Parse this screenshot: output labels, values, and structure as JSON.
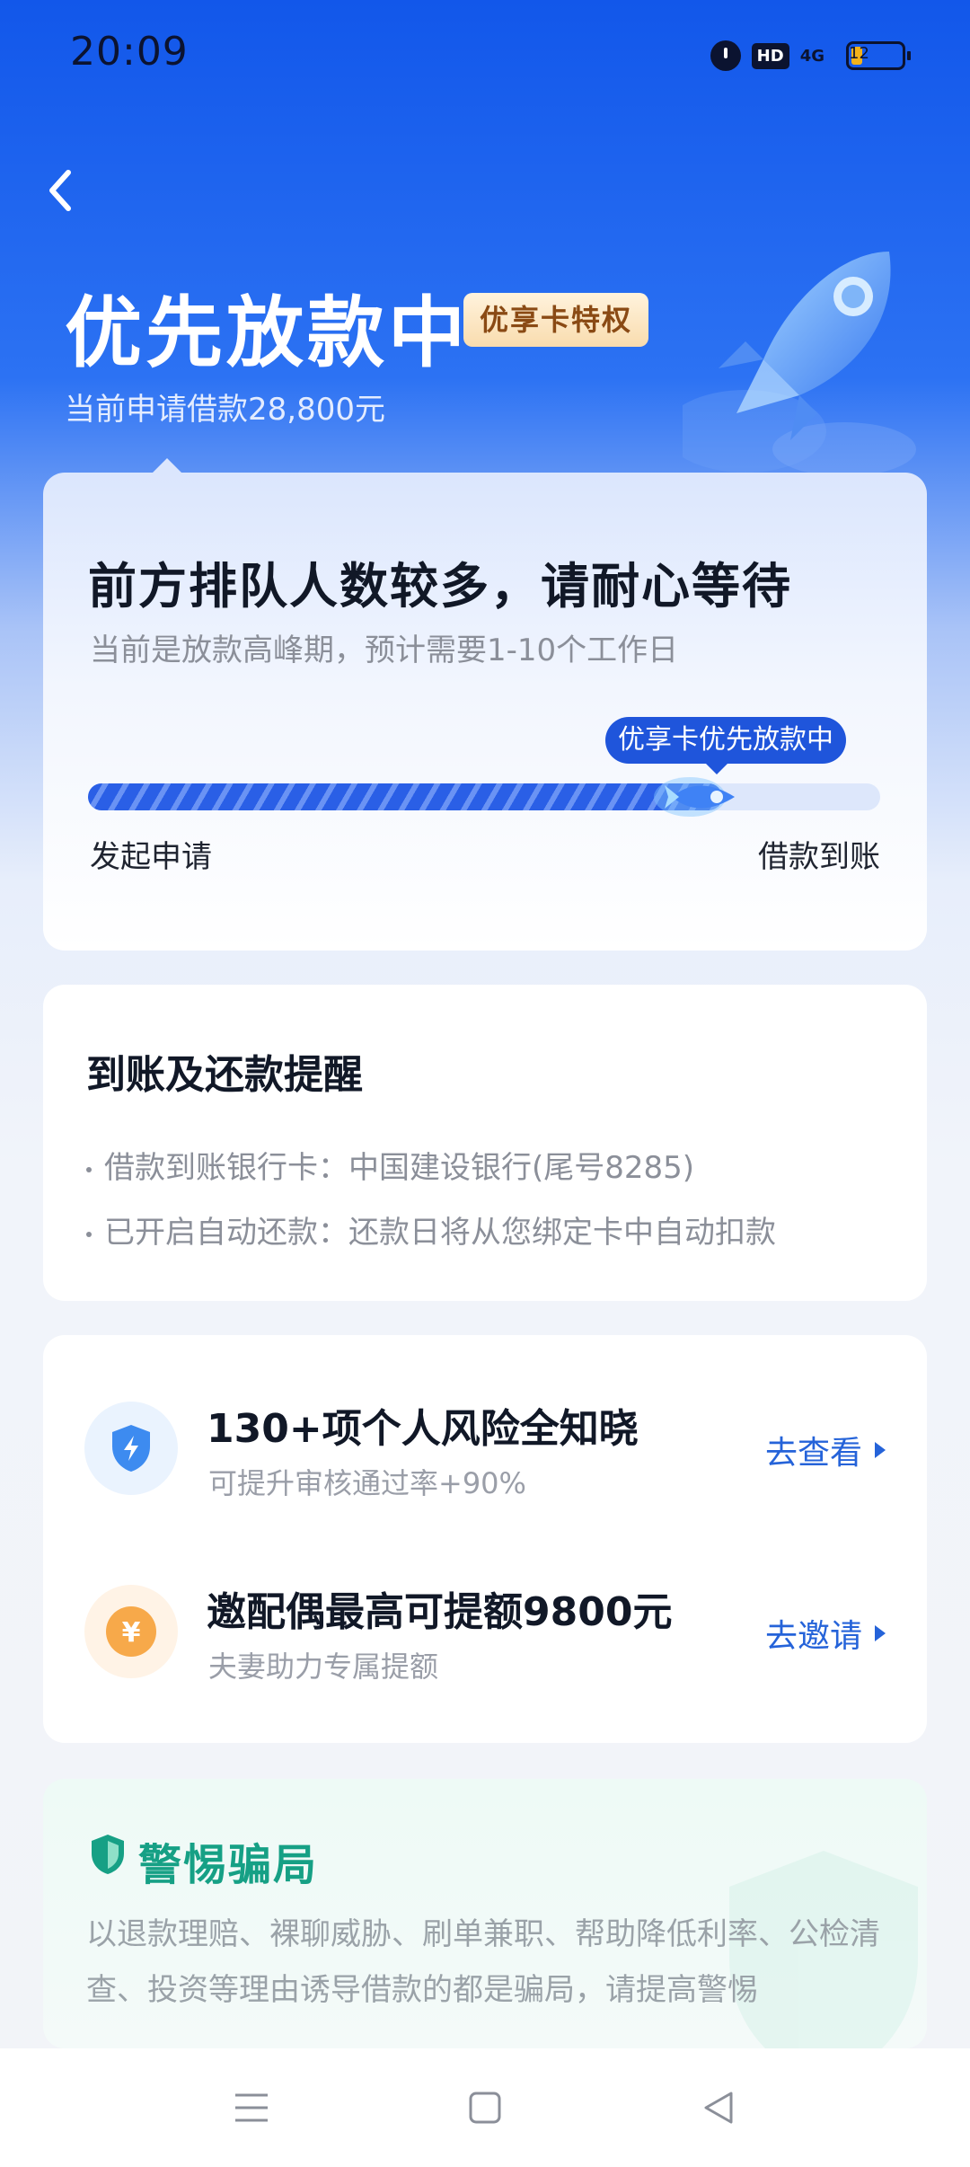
{
  "status_bar": {
    "time": "20:09",
    "hd_label": "HD",
    "network_label": "4G",
    "battery_level": "12"
  },
  "header": {
    "title": "优先放款中",
    "badge": "优享卡特权",
    "subtitle": "当前申请借款28,800元"
  },
  "status_card": {
    "title": "前方排队人数较多，请耐心等待",
    "subtitle": "当前是放款高峰期，预计需要1-10个工作日",
    "progress_tag": "优享卡优先放款中",
    "progress_fraction": 0.8,
    "start_label": "发起申请",
    "end_label": "借款到账"
  },
  "reminder_card": {
    "title": "到账及还款提醒",
    "items": [
      "借款到账银行卡：中国建设银行(尾号8285)",
      "已开启自动还款：还款日将从您绑定卡中自动扣款"
    ]
  },
  "offers": [
    {
      "title": "130+项个人风险全知晓",
      "subtitle": "可提升审核通过率+90%",
      "action": "去查看",
      "icon": "shield-lightning-icon",
      "icon_color": "#3d8bf0",
      "icon_bg": "#eaf3fe"
    },
    {
      "title": "邀配偶最高可提额9800元",
      "subtitle": "夫妻助力专属提额",
      "action": "去邀请",
      "icon": "yuan-coin-icon",
      "icon_color": "#f7a94a",
      "icon_bg": "#fff3e6"
    }
  ],
  "warning_card": {
    "title": "警惕骗局",
    "text": "以退款理赔、裸聊威胁、刷单兼职、帮助降低利率、公检清查、投资等理由诱导借款的都是骗局，请提高警惕"
  },
  "colors": {
    "brand_blue": "#1f55db",
    "link_blue": "#2563d9",
    "warning_green": "#16a085"
  }
}
